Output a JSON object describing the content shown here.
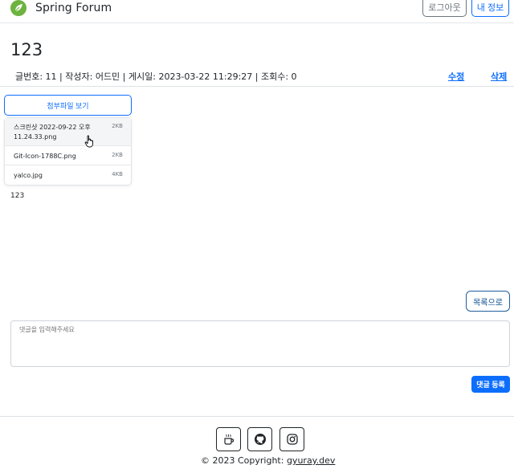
{
  "brand": {
    "name": "Spring Forum",
    "logo_icon": "spring-leaf-icon",
    "logo_color": "#6db33f"
  },
  "nav": {
    "logout_label": "로그아웃",
    "myinfo_label": "내 정보"
  },
  "post": {
    "title": "123",
    "meta": "글번호: 11 | 작성자: 어드민 | 게시일: 2023-03-22 11:29:27 | 조회수: 0",
    "edit_label": "수정",
    "delete_label": "삭제",
    "body": "123"
  },
  "attachments": {
    "toggle_label": "첨부파일 보기",
    "files": [
      {
        "name": "스크린샷 2022-09-22 오후 11.24.33.png",
        "size": "2KB"
      },
      {
        "name": "Git-Icon-1788C.png",
        "size": "2KB"
      },
      {
        "name": "yalco.jpg",
        "size": "4KB"
      }
    ]
  },
  "actions": {
    "list_label": "목록으로"
  },
  "comment": {
    "placeholder": "댓글을 입력해주세요",
    "submit_label": "댓글 등록"
  },
  "footer": {
    "icons": [
      "coffee-icon",
      "github-icon",
      "instagram-icon"
    ],
    "copyright_prefix": "© 2023 Copyright:",
    "copyright_link": "gyuray.dev"
  },
  "colors": {
    "primary": "#0d6efd",
    "secondary": "#6c757d",
    "spring_green": "#6db33f"
  }
}
